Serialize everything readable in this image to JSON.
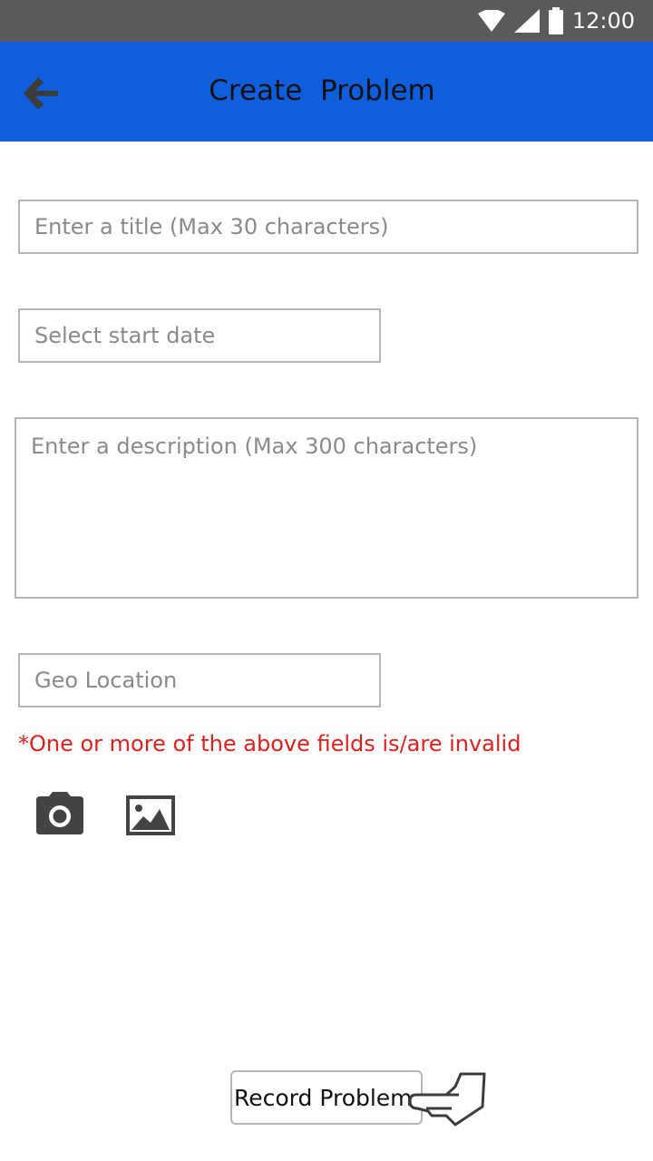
{
  "status_bar": {
    "time": "12:00",
    "icons": [
      "wifi-icon",
      "signal-icon",
      "battery-icon"
    ]
  },
  "app_bar": {
    "title": "Create  Problem",
    "back_icon": "arrow-left-icon",
    "color": "#0f5fdc"
  },
  "form": {
    "title_field": {
      "placeholder": "Enter a title (Max 30 characters)",
      "value": ""
    },
    "start_date_field": {
      "placeholder": "Select start date",
      "value": ""
    },
    "description_field": {
      "placeholder": "Enter a description (Max 300 characters)",
      "value": ""
    },
    "geo_location_field": {
      "placeholder": "Geo Location",
      "value": ""
    }
  },
  "error": {
    "message": "*One or more of the above fields is/are invalid",
    "color": "#e0201c"
  },
  "media": {
    "camera_icon": "camera-icon",
    "gallery_icon": "image-icon"
  },
  "actions": {
    "record_label": "Record Problem",
    "pointer_icon": "pointing-hand-icon"
  }
}
